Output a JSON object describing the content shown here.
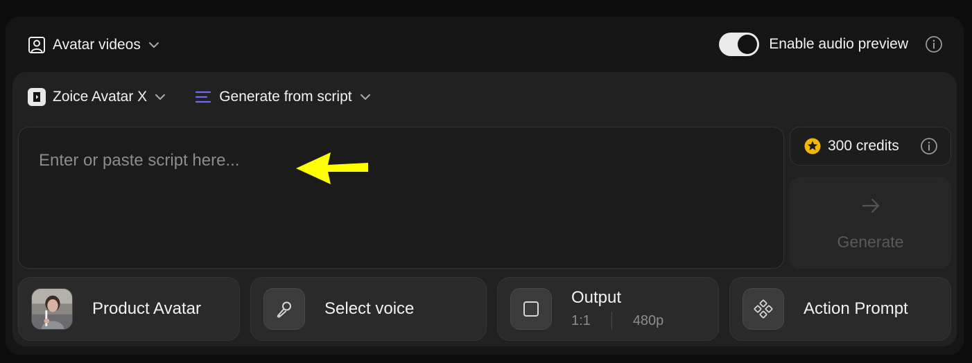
{
  "header": {
    "mode_label": "Avatar videos",
    "audio_preview_label": "Enable audio preview",
    "audio_preview_enabled": true
  },
  "model": {
    "label": "Zoice Avatar X"
  },
  "source": {
    "label": "Generate from script"
  },
  "script": {
    "placeholder": "Enter or paste script here..."
  },
  "credits": {
    "label": "300 credits"
  },
  "generate": {
    "label": "Generate"
  },
  "options": {
    "avatar": {
      "label": "Product Avatar"
    },
    "voice": {
      "label": "Select voice"
    },
    "output": {
      "label": "Output",
      "ratio": "1:1",
      "resolution": "480p"
    },
    "action": {
      "label": "Action Prompt"
    }
  },
  "colors": {
    "accent_lines": "#6c6cf0",
    "star": "#f5b800",
    "annotation_arrow": "#ffff00"
  },
  "icons": [
    "portrait-icon",
    "chevron-down-icon",
    "info-icon",
    "zoice-logo",
    "lines-icon",
    "star-icon",
    "arrow-right-icon",
    "microphone-icon",
    "square-icon",
    "diamond-grid-icon"
  ]
}
